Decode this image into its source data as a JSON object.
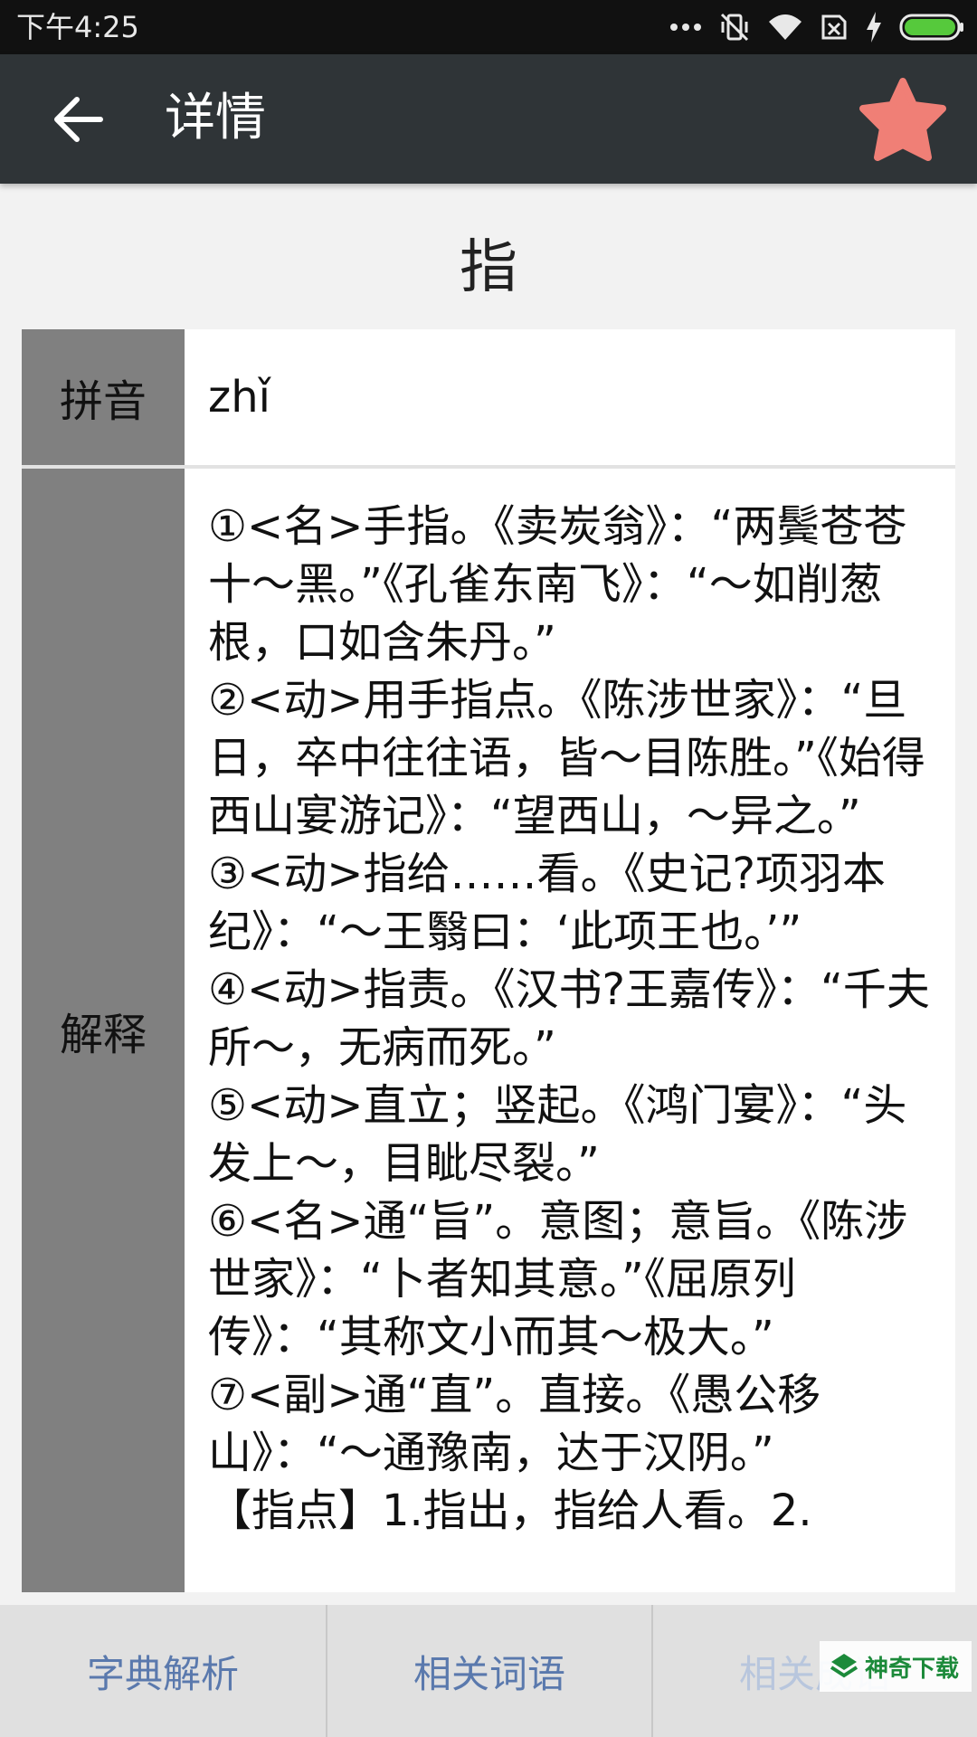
{
  "status_bar": {
    "time": "下午4:25"
  },
  "app_bar": {
    "title": "详情",
    "favorite_color": "#f07f76"
  },
  "character": "指",
  "rows": {
    "pinyin": {
      "label": "拼音",
      "value": "zhǐ"
    },
    "explanation": {
      "label": "解释",
      "text": "①<名>手指。《卖炭翁》：“两鬓苍苍十～黑。”《孔雀东南飞》：“～如削葱根，口如含朱丹。”\n②<动>用手指点。《陈涉世家》：“旦日，卒中往往语，皆～目陈胜。”《始得西山宴游记》：“望西山，～异之。”\n③<动>指给……看。《史记?项羽本纪》：“～王翳曰：‘此项王也。’”\n④<动>指责。《汉书?王嘉传》：“千夫所～，无病而死。”\n⑤<动>直立；竖起。《鸿门宴》：“头发上～，目眦尽裂。”\n⑥<名>通“旨”。意图；意旨。《陈涉世家》：“卜者知其意。”《屈原列传》：“其称文小而其～极大。”\n⑦<副>通“直”。直接。《愚公移山》：“～通豫南，达于汉阴。”\n【指点】1.指出，指给人看。2."
    }
  },
  "tabs": [
    {
      "label": "字典解析"
    },
    {
      "label": "相关词语"
    },
    {
      "label": "相关成语"
    }
  ],
  "watermark": {
    "text": "神奇下载"
  }
}
